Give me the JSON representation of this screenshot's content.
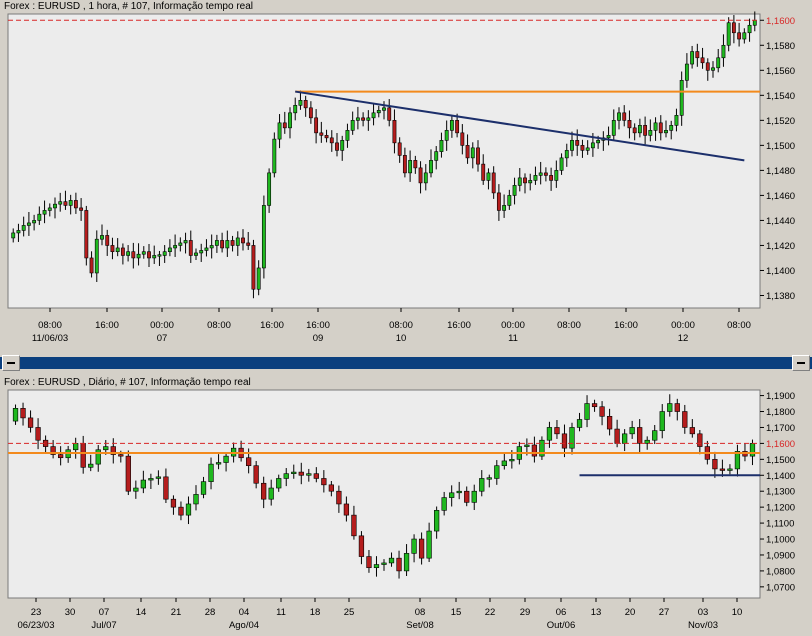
{
  "panes": [
    {
      "title": "Forex : EURUSD , 1 hora, # 107, Informação tempo real",
      "chart_data": {
        "type": "candlestick",
        "ylim": [
          1.137,
          1.1605
        ],
        "yticks": [
          "1,1600",
          "1,1580",
          "1,1560",
          "1,1540",
          "1,1520",
          "1,1500",
          "1,1480",
          "1,1460",
          "1,1440",
          "1,1420",
          "1,1400",
          "1,1380"
        ],
        "xticks": [
          {
            "time": "08:00",
            "date": "11/06/03"
          },
          {
            "time": "16:00",
            "date": ""
          },
          {
            "time": "00:00",
            "date": "07"
          },
          {
            "time": "08:00",
            "date": ""
          },
          {
            "time": "16:00",
            "date": ""
          },
          {
            "time": "16:00",
            "date": "09"
          },
          {
            "time": "08:00",
            "date": "10"
          },
          {
            "time": "16:00",
            "date": ""
          },
          {
            "time": "00:00",
            "date": "11"
          },
          {
            "time": "08:00",
            "date": ""
          },
          {
            "time": "16:00",
            "date": ""
          },
          {
            "time": "00:00",
            "date": "12"
          },
          {
            "time": "08:00",
            "date": ""
          }
        ],
        "hline_dashed": 1.16,
        "hline_orange": 1.1543,
        "trendline": {
          "from": [
            54,
            1.1543
          ],
          "to": [
            140,
            1.1488
          ]
        },
        "candles_count": 143,
        "closes": [
          1.143,
          1.1432,
          1.1436,
          1.1438,
          1.144,
          1.1445,
          1.1448,
          1.145,
          1.1453,
          1.1455,
          1.1452,
          1.1456,
          1.145,
          1.1448,
          1.141,
          1.1398,
          1.1425,
          1.1428,
          1.142,
          1.1415,
          1.1418,
          1.1412,
          1.1415,
          1.141,
          1.1413,
          1.1415,
          1.141,
          1.1412,
          1.1412,
          1.1415,
          1.1418,
          1.142,
          1.1422,
          1.1424,
          1.1412,
          1.1414,
          1.1416,
          1.1418,
          1.142,
          1.1424,
          1.1418,
          1.1424,
          1.142,
          1.1426,
          1.1422,
          1.142,
          1.1385,
          1.1402,
          1.1452,
          1.1478,
          1.1505,
          1.1518,
          1.1514,
          1.1526,
          1.1532,
          1.1536,
          1.153,
          1.1522,
          1.151,
          1.1508,
          1.1506,
          1.1502,
          1.1496,
          1.1504,
          1.1512,
          1.152,
          1.1522,
          1.152,
          1.1522,
          1.1526,
          1.1528,
          1.153,
          1.152,
          1.1502,
          1.1492,
          1.1478,
          1.1488,
          1.1482,
          1.147,
          1.1478,
          1.1488,
          1.1495,
          1.1504,
          1.1512,
          1.152,
          1.151,
          1.15,
          1.149,
          1.1498,
          1.1485,
          1.1472,
          1.1478,
          1.1462,
          1.1448,
          1.1452,
          1.146,
          1.1468,
          1.1474,
          1.147,
          1.1472,
          1.1476,
          1.1478,
          1.1476,
          1.1472,
          1.148,
          1.149,
          1.1496,
          1.1504,
          1.15,
          1.1496,
          1.1498,
          1.1502,
          1.1504,
          1.1506,
          1.1508,
          1.152,
          1.1526,
          1.152,
          1.1514,
          1.151,
          1.1516,
          1.1508,
          1.1512,
          1.1518,
          1.151,
          1.1512,
          1.1516,
          1.1524,
          1.1552,
          1.1565,
          1.1575,
          1.157,
          1.1566,
          1.156,
          1.1562,
          1.157,
          1.158,
          1.1598,
          1.159,
          1.1585,
          1.159,
          1.1596,
          1.16
        ]
      }
    },
    {
      "title": "Forex : EURUSD , Diário, # 107, Informação tempo real",
      "chart_data": {
        "type": "candlestick",
        "ylim": [
          1.063,
          1.1935
        ],
        "yticks": [
          "1,1900",
          "1,1800",
          "1,1700",
          "1,1600",
          "1,1500",
          "1,1400",
          "1,1300",
          "1,1200",
          "1,1100",
          "1,1000",
          "1,0900",
          "1,0800",
          "1,0700"
        ],
        "xticks": [
          {
            "label": "23",
            "date": "06/23/03"
          },
          {
            "label": "30",
            "date": ""
          },
          {
            "label": "07",
            "date": "Jul/07"
          },
          {
            "label": "14",
            "date": ""
          },
          {
            "label": "21",
            "date": ""
          },
          {
            "label": "28",
            "date": ""
          },
          {
            "label": "04",
            "date": "Ago/04"
          },
          {
            "label": "11",
            "date": ""
          },
          {
            "label": "18",
            "date": ""
          },
          {
            "label": "25",
            "date": ""
          },
          {
            "label": "08",
            "date": "Set/08"
          },
          {
            "label": "15",
            "date": ""
          },
          {
            "label": "22",
            "date": ""
          },
          {
            "label": "29",
            "date": ""
          },
          {
            "label": "06",
            "date": "Out/06"
          },
          {
            "label": "13",
            "date": ""
          },
          {
            "label": "20",
            "date": ""
          },
          {
            "label": "27",
            "date": ""
          },
          {
            "label": "03",
            "date": "Nov/03"
          },
          {
            "label": "10",
            "date": ""
          }
        ],
        "hline_dashed": 1.16,
        "hline_orange": 1.154,
        "support_line": {
          "from": [
            75,
            1.14
          ],
          "to": [
            107,
            1.14
          ]
        },
        "closes": [
          1.182,
          1.176,
          1.17,
          1.162,
          1.158,
          1.153,
          1.151,
          1.156,
          1.16,
          1.145,
          1.147,
          1.156,
          1.158,
          1.153,
          1.152,
          1.13,
          1.132,
          1.137,
          1.138,
          1.139,
          1.125,
          1.12,
          1.115,
          1.122,
          1.128,
          1.136,
          1.147,
          1.148,
          1.152,
          1.157,
          1.151,
          1.146,
          1.135,
          1.125,
          1.132,
          1.138,
          1.141,
          1.142,
          1.14,
          1.141,
          1.138,
          1.134,
          1.13,
          1.122,
          1.115,
          1.102,
          1.089,
          1.082,
          1.084,
          1.085,
          1.088,
          1.08,
          1.091,
          1.1,
          1.088,
          1.105,
          1.118,
          1.126,
          1.129,
          1.13,
          1.123,
          1.13,
          1.138,
          1.138,
          1.146,
          1.149,
          1.15,
          1.158,
          1.159,
          1.152,
          1.162,
          1.17,
          1.166,
          1.157,
          1.17,
          1.175,
          1.185,
          1.183,
          1.177,
          1.169,
          1.16,
          1.166,
          1.17,
          1.16,
          1.162,
          1.168,
          1.18,
          1.185,
          1.18,
          1.17,
          1.166,
          1.158,
          1.15,
          1.144,
          1.143,
          1.144,
          1.155,
          1.152,
          1.16
        ]
      }
    }
  ],
  "colors": {
    "bg": "#d4d0c8",
    "plot": "#ececec",
    "up": "#1fb81f",
    "down": "#b51d1d",
    "dashed": "#d82626",
    "orange": "#f38a1c",
    "trend": "#1c2f6b",
    "divider": "#0b3f7e"
  }
}
